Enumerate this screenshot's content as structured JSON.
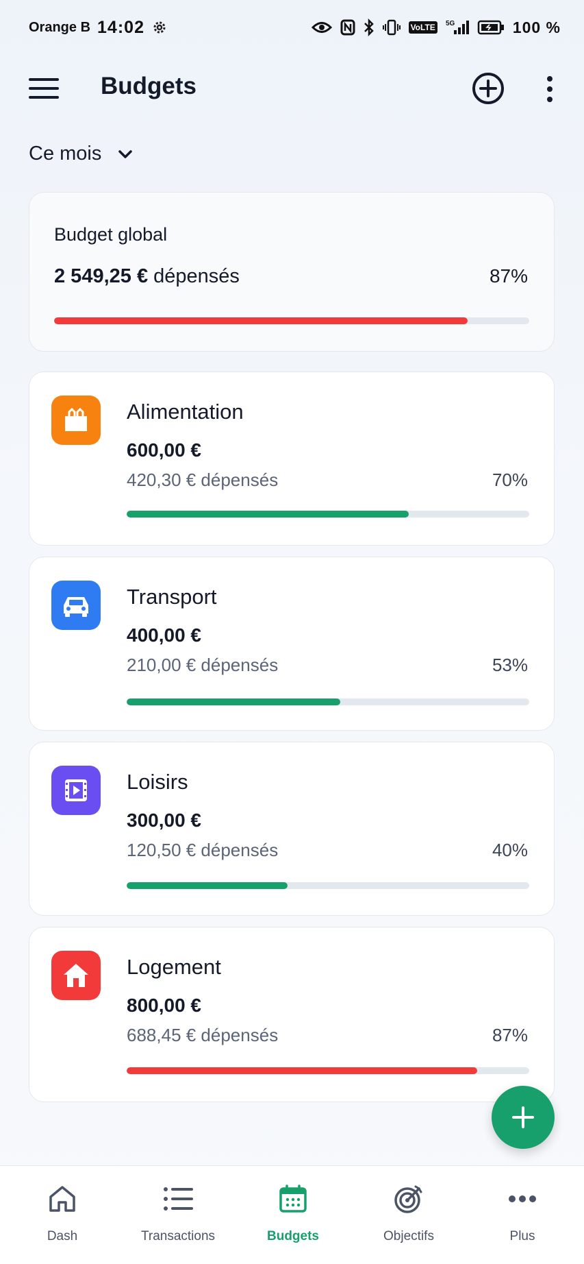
{
  "status_bar": {
    "carrier": "Orange B",
    "time": "14:02",
    "network_label": "VoLTE",
    "signal_label": "5G",
    "battery": "100 %"
  },
  "app_bar": {
    "title": "Budgets",
    "icons": [
      "menu-icon",
      "add-circle-icon",
      "more-vertical-icon"
    ]
  },
  "period": {
    "label": "Ce mois",
    "icon": "chevron-down-icon"
  },
  "global": {
    "title": "Budget global",
    "amount": "2 549,25 €",
    "spent_suffix": "dépensés",
    "percent_label": "87%",
    "progress": 0.87,
    "color": "#f23a3a"
  },
  "categories": [
    {
      "name": "Alimentation",
      "budget": "600,00 €",
      "spent": "420,30 € dépensés",
      "percent_label": "70%",
      "progress": 0.7,
      "icon": "shopping-bag-icon",
      "icon_color": "#f8820f",
      "bar_color": "#17a06b"
    },
    {
      "name": "Transport",
      "budget": "400,00 €",
      "spent": "210,00 € dépensés",
      "percent_label": "53%",
      "progress": 0.53,
      "icon": "car-icon",
      "icon_color": "#2f7bf2",
      "bar_color": "#17a06b"
    },
    {
      "name": "Loisirs",
      "budget": "300,00 €",
      "spent": "120,50 € dépensés",
      "percent_label": "40%",
      "progress": 0.4,
      "icon": "film-icon",
      "icon_color": "#6a4ef2",
      "bar_color": "#17a06b"
    },
    {
      "name": "Logement",
      "budget": "800,00 €",
      "spent": "688,45 € dépensés",
      "percent_label": "87%",
      "progress": 0.87,
      "icon": "home-icon",
      "icon_color": "#f23a3a",
      "bar_color": "#f23a3a"
    }
  ],
  "fab": {
    "icon": "plus-icon",
    "color": "#17a06b"
  },
  "bottom_nav": [
    {
      "label": "Dash",
      "icon": "home-outline-icon",
      "active": false
    },
    {
      "label": "Transactions",
      "icon": "list-icon",
      "active": false
    },
    {
      "label": "Budgets",
      "icon": "calendar-icon",
      "active": true
    },
    {
      "label": "Objectifs",
      "icon": "target-icon",
      "active": false
    },
    {
      "label": "Plus",
      "icon": "more-horizontal-icon",
      "active": false
    }
  ]
}
